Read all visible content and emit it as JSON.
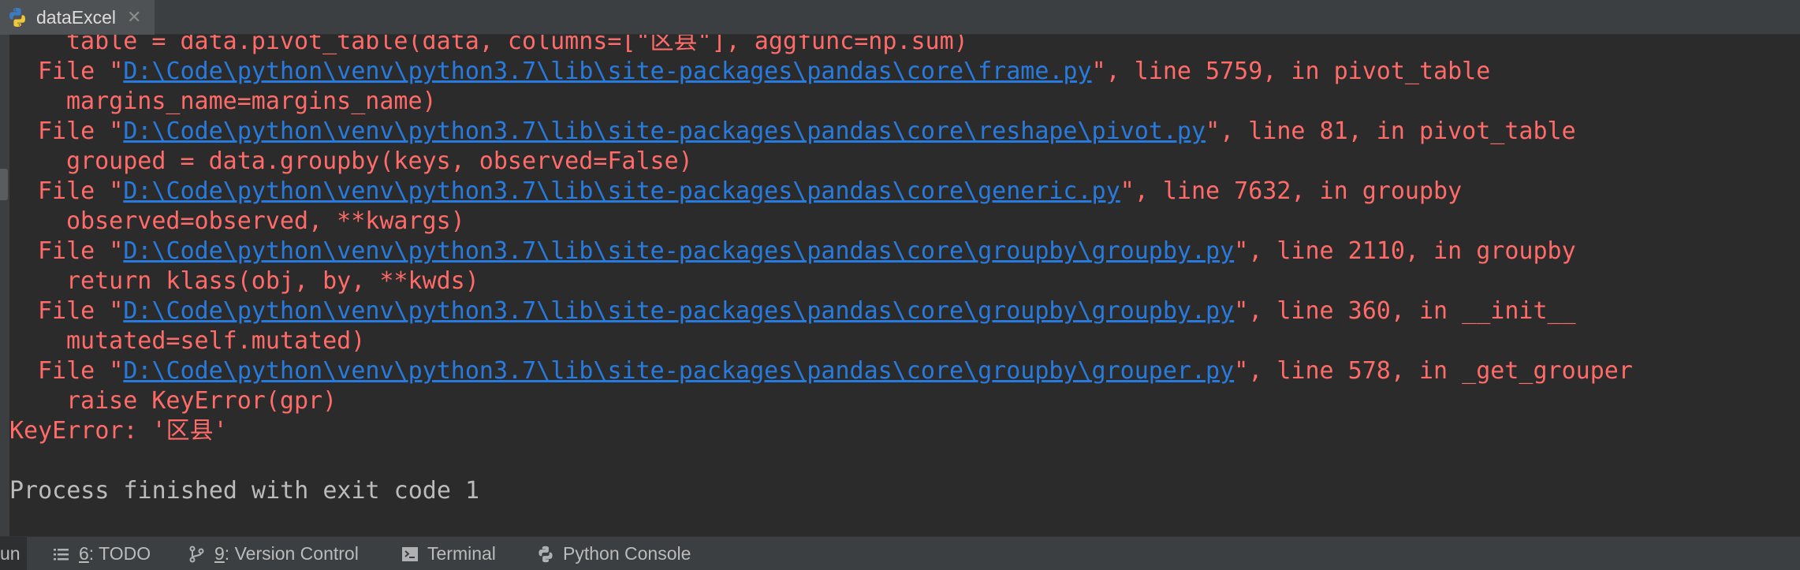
{
  "tab": {
    "title": "dataExcel",
    "close_glyph": "✕",
    "icon": "python-icon"
  },
  "console": {
    "lines": [
      {
        "indent": "    ",
        "pre": "table = data.pivot_table(data, columns=[\"区县\"], aggfunc=np.sum)",
        "link": "",
        "post": ""
      },
      {
        "indent": "  ",
        "pre": "File \"",
        "link": "D:\\Code\\python\\venv\\python3.7\\lib\\site-packages\\pandas\\core\\frame.py",
        "post": "\", line 5759, in pivot_table"
      },
      {
        "indent": "    ",
        "pre": "margins_name=margins_name)",
        "link": "",
        "post": ""
      },
      {
        "indent": "  ",
        "pre": "File \"",
        "link": "D:\\Code\\python\\venv\\python3.7\\lib\\site-packages\\pandas\\core\\reshape\\pivot.py",
        "post": "\", line 81, in pivot_table"
      },
      {
        "indent": "    ",
        "pre": "grouped = data.groupby(keys, observed=False)",
        "link": "",
        "post": ""
      },
      {
        "indent": "  ",
        "pre": "File \"",
        "link": "D:\\Code\\python\\venv\\python3.7\\lib\\site-packages\\pandas\\core\\generic.py",
        "post": "\", line 7632, in groupby"
      },
      {
        "indent": "    ",
        "pre": "observed=observed, **kwargs)",
        "link": "",
        "post": ""
      },
      {
        "indent": "  ",
        "pre": "File \"",
        "link": "D:\\Code\\python\\venv\\python3.7\\lib\\site-packages\\pandas\\core\\groupby\\groupby.py",
        "post": "\", line 2110, in groupby"
      },
      {
        "indent": "    ",
        "pre": "return klass(obj, by, **kwds)",
        "link": "",
        "post": ""
      },
      {
        "indent": "  ",
        "pre": "File \"",
        "link": "D:\\Code\\python\\venv\\python3.7\\lib\\site-packages\\pandas\\core\\groupby\\groupby.py",
        "post": "\", line 360, in __init__"
      },
      {
        "indent": "    ",
        "pre": "mutated=self.mutated)",
        "link": "",
        "post": ""
      },
      {
        "indent": "  ",
        "pre": "File \"",
        "link": "D:\\Code\\python\\venv\\python3.7\\lib\\site-packages\\pandas\\core\\groupby\\grouper.py",
        "post": "\", line 578, in _get_grouper"
      },
      {
        "indent": "    ",
        "pre": "raise KeyError(gpr)",
        "link": "",
        "post": ""
      },
      {
        "indent": "",
        "pre": "KeyError: '区县'",
        "link": "",
        "post": ""
      },
      {
        "indent": "",
        "pre": "",
        "link": "",
        "post": ""
      },
      {
        "indent": "",
        "pre": "Process finished with exit code 1",
        "link": "",
        "post": "",
        "normal": true
      }
    ]
  },
  "bottombar": {
    "run": "un",
    "todo": {
      "mnemonic": "6",
      "label": ": TODO"
    },
    "vcs": {
      "mnemonic": "9",
      "label": ": Version Control"
    },
    "terminal": "Terminal",
    "python_console": "Python Console"
  },
  "colors": {
    "error": "#ff6b68",
    "link": "#287bde",
    "normal": "#bbbbbb",
    "background": "#2b2b2b"
  }
}
